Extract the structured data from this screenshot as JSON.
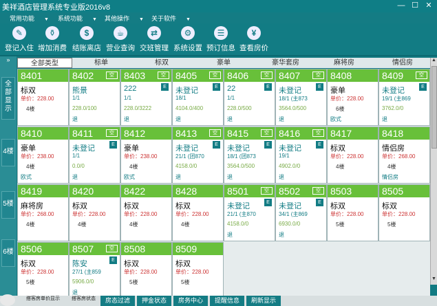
{
  "window": {
    "title": "美祥酒店管理系统专业版2016v8",
    "minimize": "—",
    "maximize": "☐",
    "close": "✕"
  },
  "menu": [
    {
      "label": "常用功能"
    },
    {
      "label": "系统功能"
    },
    {
      "label": "其他操作"
    },
    {
      "label": "关于软件"
    }
  ],
  "toolbar": [
    {
      "label": "登记入住",
      "icon": "pen-icon",
      "glyph": "✎"
    },
    {
      "label": "增加消费",
      "icon": "bottle-icon",
      "glyph": "⚱"
    },
    {
      "label": "结账离店",
      "icon": "bill-icon",
      "glyph": "$"
    },
    {
      "label": "营业查询",
      "icon": "coffee-icon",
      "glyph": "☕"
    },
    {
      "label": "交班管理",
      "icon": "handover-icon",
      "glyph": "⇄"
    },
    {
      "label": "系统设置",
      "icon": "gear-icon",
      "glyph": "⚙"
    },
    {
      "label": "预订信息",
      "icon": "booking-icon",
      "glyph": "☰"
    },
    {
      "label": "查看房价",
      "icon": "price-icon",
      "glyph": "¥"
    }
  ],
  "sidebar": {
    "toggle": "»",
    "items": [
      {
        "label": "全部显示"
      },
      {
        "label": "4楼"
      },
      {
        "label": "5楼"
      },
      {
        "label": "6楼"
      }
    ]
  },
  "tabs": [
    {
      "label": "全部类型"
    },
    {
      "label": "标单"
    },
    {
      "label": "标双"
    },
    {
      "label": "豪单"
    },
    {
      "label": "豪华套房"
    },
    {
      "label": "麻将房"
    },
    {
      "label": "情侣房"
    }
  ],
  "rooms": [
    {
      "number": "8401",
      "badge": "",
      "name": "标双",
      "guest": false,
      "line2": "单价：228.00",
      "line3": "4楼",
      "tag": "",
      "icon": ""
    },
    {
      "number": "8402",
      "badge": "空",
      "name": "熊景",
      "guest": true,
      "line2": "1/1",
      "line3": "228.0/100",
      "tag": "退",
      "icon": ""
    },
    {
      "number": "8403",
      "badge": "空",
      "name": "222",
      "guest": true,
      "line2": "1/1",
      "line3": "228.0/3222",
      "tag": "退",
      "icon": "E"
    },
    {
      "number": "8405",
      "badge": "空",
      "name": "未登记",
      "guest": true,
      "line2": "18/1",
      "line3": "4104.0/400",
      "tag": "退",
      "icon": "E"
    },
    {
      "number": "8406",
      "badge": "空",
      "name": "22",
      "guest": true,
      "line2": "1/1",
      "line3": "228.0/500",
      "tag": "退",
      "icon": "E"
    },
    {
      "number": "8407",
      "badge": "空",
      "name": "未登记",
      "guest": true,
      "line2": "18/1 (主873",
      "line3": "3564.0/500",
      "tag": "退",
      "icon": "E"
    },
    {
      "number": "8408",
      "badge": "",
      "name": "豪单",
      "guest": false,
      "line2": "单价：228.00",
      "line3": "6楼",
      "tag": "欧式",
      "icon": ""
    },
    {
      "number": "8409",
      "badge": "空",
      "name": "未登记",
      "guest": true,
      "line2": "19/1 (主869",
      "line3": "3762.0/0",
      "tag": "退",
      "icon": "E"
    },
    {
      "number": "8410",
      "badge": "",
      "name": "豪单",
      "guest": false,
      "line2": "单价：238.00",
      "line3": "4楼",
      "tag": "欧式",
      "icon": ""
    },
    {
      "number": "8411",
      "badge": "空",
      "name": "未登记",
      "guest": true,
      "line2": "1/1",
      "line3": "0.0/0",
      "tag": "退",
      "icon": "E"
    },
    {
      "number": "8412",
      "badge": "",
      "name": "豪单",
      "guest": false,
      "line2": "单价：238.00",
      "line3": "4楼",
      "tag": "欧式",
      "icon": ""
    },
    {
      "number": "8413",
      "badge": "空",
      "name": "未登记",
      "guest": true,
      "line2": "21/1 (团870",
      "line3": "4158.0/0",
      "tag": "退",
      "icon": "E"
    },
    {
      "number": "8415",
      "badge": "空",
      "name": "未登记",
      "guest": true,
      "line2": "18/1 (团873",
      "line3": "3564.0/500",
      "tag": "退",
      "icon": "E"
    },
    {
      "number": "8416",
      "badge": "空",
      "name": "未登记",
      "guest": true,
      "line2": "19/1",
      "line3": "4902.0/0",
      "tag": "退",
      "icon": "E"
    },
    {
      "number": "8417",
      "badge": "",
      "name": "标双",
      "guest": false,
      "line2": "单价：228.00",
      "line3": "4楼",
      "tag": "",
      "icon": ""
    },
    {
      "number": "8418",
      "badge": "",
      "name": "情侣房",
      "guest": false,
      "line2": "单价：268.00",
      "line3": "4楼",
      "tag": "情侣房",
      "icon": ""
    },
    {
      "number": "8419",
      "badge": "",
      "name": "麻将房",
      "guest": false,
      "line2": "单价：268.00",
      "line3": "4楼",
      "tag": "",
      "icon": ""
    },
    {
      "number": "8420",
      "badge": "",
      "name": "标双",
      "guest": false,
      "line2": "单价：228.00",
      "line3": "4楼",
      "tag": "",
      "icon": ""
    },
    {
      "number": "8422",
      "badge": "",
      "name": "标双",
      "guest": false,
      "line2": "单价：228.00",
      "line3": "4楼",
      "tag": "",
      "icon": ""
    },
    {
      "number": "8428",
      "badge": "",
      "name": "标双",
      "guest": false,
      "line2": "单价：228.00",
      "line3": "4楼",
      "tag": "",
      "icon": ""
    },
    {
      "number": "8501",
      "badge": "空",
      "name": "未登记",
      "guest": true,
      "line2": "21/1 (主870",
      "line3": "4158.0/0",
      "tag": "退",
      "icon": "E"
    },
    {
      "number": "8502",
      "badge": "空",
      "name": "未登记",
      "guest": true,
      "line2": "34/1 (主869",
      "line3": "6930.0/0",
      "tag": "退",
      "icon": "E"
    },
    {
      "number": "8503",
      "badge": "",
      "name": "标双",
      "guest": false,
      "line2": "单价：228.00",
      "line3": "5楼",
      "tag": "",
      "icon": ""
    },
    {
      "number": "8505",
      "badge": "",
      "name": "标双",
      "guest": false,
      "line2": "单价：228.00",
      "line3": "5楼",
      "tag": "",
      "icon": ""
    },
    {
      "number": "8506",
      "badge": "",
      "name": "标双",
      "guest": false,
      "line2": "单价：228.00",
      "line3": "5楼",
      "tag": "",
      "icon": ""
    },
    {
      "number": "8507",
      "badge": "空",
      "name": "陈安",
      "guest": true,
      "line2": "27/1 (主859",
      "line3": "5906.0/0",
      "tag": "退",
      "icon": "E"
    },
    {
      "number": "8508",
      "badge": "",
      "name": "标双",
      "guest": false,
      "line2": "单价：228.00",
      "line3": "5楼",
      "tag": "",
      "icon": ""
    },
    {
      "number": "8509",
      "badge": "",
      "name": "标双",
      "guest": false,
      "line2": "单价：228.00",
      "line3": "5楼",
      "tag": "",
      "icon": ""
    }
  ],
  "status": {
    "hint1": "搭客房单价显示",
    "hint2": "搭客房状态",
    "buttons": [
      {
        "label": "房态过滤"
      },
      {
        "label": "押金状态"
      },
      {
        "label": "房务中心"
      },
      {
        "label": "提醒信息"
      },
      {
        "label": "刷新显示"
      }
    ]
  }
}
